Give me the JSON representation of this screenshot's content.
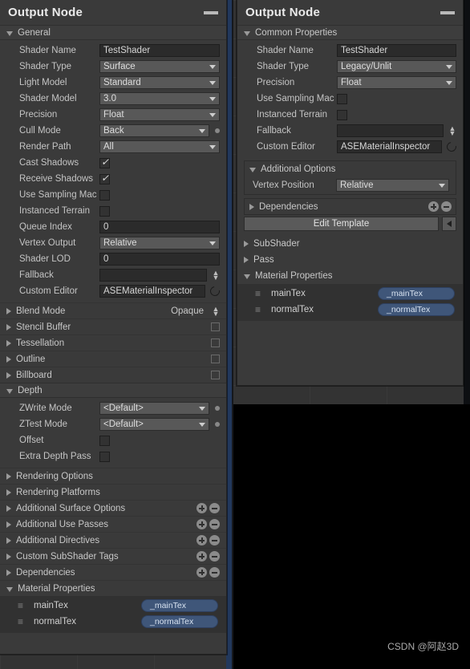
{
  "watermark": "CSDN @阿赵3D",
  "left_panel": {
    "title": "Output Node",
    "minimize_icon": "minimize-icon",
    "general_section": {
      "label": "General",
      "expanded": true,
      "rows": [
        {
          "label": "Shader Name",
          "type": "text",
          "value": "TestShader"
        },
        {
          "label": "Shader Type",
          "type": "dropdown",
          "value": "Surface"
        },
        {
          "label": "Light Model",
          "type": "dropdown",
          "value": "Standard"
        },
        {
          "label": "Shader Model",
          "type": "dropdown",
          "value": "3.0"
        },
        {
          "label": "Precision",
          "type": "dropdown",
          "value": "Float"
        },
        {
          "label": "Cull Mode",
          "type": "dropdown",
          "value": "Back",
          "dot": true
        },
        {
          "label": "Render Path",
          "type": "dropdown",
          "value": "All"
        },
        {
          "label": "Cast Shadows",
          "type": "checkbox",
          "checked": true
        },
        {
          "label": "Receive Shadows",
          "type": "checkbox",
          "checked": true
        },
        {
          "label": "Use Sampling Mac",
          "type": "checkbox",
          "checked": false
        },
        {
          "label": "Instanced Terrain",
          "type": "checkbox",
          "checked": false
        },
        {
          "label": "Queue Index",
          "type": "text",
          "value": "0"
        },
        {
          "label": "Vertex Output",
          "type": "dropdown",
          "value": "Relative"
        },
        {
          "label": "Shader LOD",
          "type": "text",
          "value": "0"
        },
        {
          "label": "Fallback",
          "type": "text",
          "value": "",
          "stepper": true
        },
        {
          "label": "Custom Editor",
          "type": "text",
          "value": "ASEMaterialInspector",
          "reload": true
        }
      ]
    },
    "foldouts": [
      {
        "label": "Blend Mode",
        "expanded": false,
        "right_value": "Opaque",
        "stepper": true
      },
      {
        "label": "Stencil Buffer",
        "expanded": false,
        "checkbox": false
      },
      {
        "label": "Tessellation",
        "expanded": false,
        "checkbox": false
      },
      {
        "label": "Outline",
        "expanded": false,
        "checkbox": false
      },
      {
        "label": "Billboard",
        "expanded": false,
        "checkbox": false
      }
    ],
    "depth_section": {
      "label": "Depth",
      "expanded": true,
      "rows": [
        {
          "label": "ZWrite Mode",
          "type": "dropdown",
          "value": "<Default>",
          "dot": true
        },
        {
          "label": "ZTest Mode",
          "type": "dropdown",
          "value": "<Default>",
          "dot": true
        },
        {
          "label": "Offset",
          "type": "checkbox",
          "checked": false
        },
        {
          "label": "Extra Depth Pass",
          "type": "checkbox",
          "checked": false
        }
      ]
    },
    "bottom_foldouts": [
      {
        "label": "Rendering Options",
        "expanded": false,
        "addremove": false
      },
      {
        "label": "Rendering Platforms",
        "expanded": false,
        "addremove": false
      },
      {
        "label": "Additional Surface Options",
        "expanded": false,
        "addremove": true
      },
      {
        "label": "Additional Use Passes",
        "expanded": false,
        "addremove": true
      },
      {
        "label": "Additional Directives",
        "expanded": false,
        "addremove": true
      },
      {
        "label": "Custom SubShader Tags",
        "expanded": false,
        "addremove": true
      },
      {
        "label": "Dependencies",
        "expanded": false,
        "addremove": true
      }
    ],
    "material_properties": {
      "label": "Material Properties",
      "expanded": true,
      "items": [
        {
          "name": "mainTex",
          "pill": "_mainTex"
        },
        {
          "name": "normalTex",
          "pill": "_normalTex"
        }
      ]
    }
  },
  "right_panel": {
    "title": "Output Node",
    "minimize_icon": "minimize-icon",
    "common_properties": {
      "label": "Common Properties",
      "expanded": true,
      "rows": [
        {
          "label": "Shader Name",
          "type": "text",
          "value": "TestShader"
        },
        {
          "label": "Shader Type",
          "type": "dropdown",
          "value": "Legacy/Unlit"
        },
        {
          "label": "Precision",
          "type": "dropdown",
          "value": "Float"
        },
        {
          "label": "Use Sampling Mac",
          "type": "checkbox",
          "checked": false
        },
        {
          "label": "Instanced Terrain",
          "type": "checkbox",
          "checked": false
        },
        {
          "label": "Fallback",
          "type": "text",
          "value": "",
          "stepper": true
        },
        {
          "label": "Custom Editor",
          "type": "text",
          "value": "ASEMaterialInspector",
          "reload": true
        }
      ]
    },
    "additional_options": {
      "label": "Additional Options",
      "expanded": true,
      "rows": [
        {
          "label": "Vertex Position",
          "type": "dropdown",
          "value": "Relative"
        }
      ]
    },
    "dependencies": {
      "label": "Dependencies",
      "expanded": false
    },
    "edit_template_label": "Edit Template",
    "back_icon": "back-arrow-icon",
    "foldouts": [
      {
        "label": "SubShader",
        "expanded": false
      },
      {
        "label": "Pass",
        "expanded": false
      }
    ],
    "material_properties": {
      "label": "Material Properties",
      "expanded": true,
      "items": [
        {
          "name": "mainTex",
          "pill": "_mainTex"
        },
        {
          "name": "normalTex",
          "pill": "_normalTex"
        }
      ]
    }
  },
  "colors": {
    "panel_bg": "#3a3a3a",
    "section_bg": "#3d3d3d",
    "field_bg": "#2b2b2b",
    "dropdown_bg": "#585858",
    "pill_bg": "#3f5679",
    "graph_bg": "#333333",
    "accent_strip": "#22385c"
  }
}
